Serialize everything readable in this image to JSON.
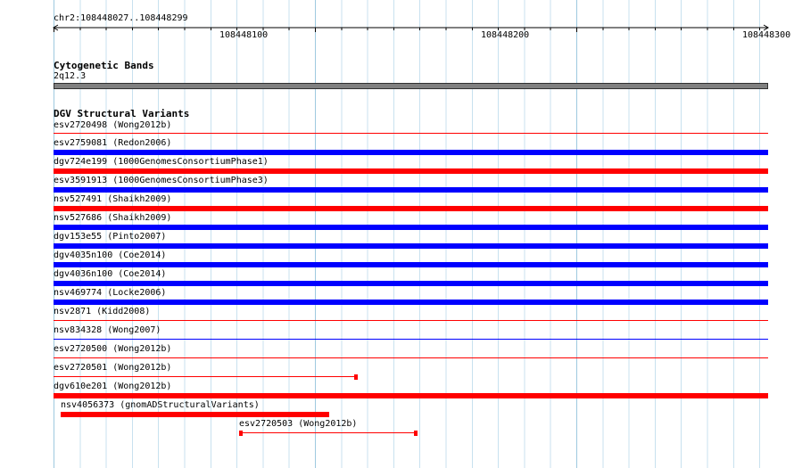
{
  "location_label": "chr2:108448027..108448299",
  "ruler_ticks": [
    "108448100",
    "108448200",
    "108448300"
  ],
  "cytogenetic_bands": {
    "title": "Cytogenetic Bands",
    "band_label": "2q12.3"
  },
  "dgv": {
    "title": "DGV Structural Variants",
    "colors": {
      "loss": "#ff0000",
      "gain": "#0000ff"
    },
    "features": [
      {
        "label": "esv2720498 (Wong2012b)",
        "color": "#ff0000",
        "style": "thin"
      },
      {
        "label": "esv2759081 (Redon2006)",
        "color": "#0000ff",
        "style": "thick"
      },
      {
        "label": "dgv724e199 (1000GenomesConsortiumPhase1)",
        "color": "#ff0000",
        "style": "thick"
      },
      {
        "label": "esv3591913 (1000GenomesConsortiumPhase3)",
        "color": "#0000ff",
        "style": "thick"
      },
      {
        "label": "nsv527491 (Shaikh2009)",
        "color": "#ff0000",
        "style": "thick"
      },
      {
        "label": "nsv527686 (Shaikh2009)",
        "color": "#0000ff",
        "style": "thick"
      },
      {
        "label": "dgv153e55 (Pinto2007)",
        "color": "#0000ff",
        "style": "thick"
      },
      {
        "label": "dgv4035n100 (Coe2014)",
        "color": "#0000ff",
        "style": "thick"
      },
      {
        "label": "dgv4036n100 (Coe2014)",
        "color": "#0000ff",
        "style": "thick"
      },
      {
        "label": "nsv469774 (Locke2006)",
        "color": "#0000ff",
        "style": "thick"
      },
      {
        "label": "nsv2871 (Kidd2008)",
        "color": "#ff0000",
        "style": "thin"
      },
      {
        "label": "nsv834328 (Wong2007)",
        "color": "#0000ff",
        "style": "thin"
      },
      {
        "label": "esv2720500 (Wong2012b)",
        "color": "#ff0000",
        "style": "thin"
      },
      {
        "label": "esv2720501 (Wong2012b)",
        "color": "#ff0000",
        "style": "thin-end"
      },
      {
        "label": "dgv610e201 (Wong2012b)",
        "color": "#ff0000",
        "style": "thick"
      },
      {
        "label": "nsv4056373 (gnomADStructuralVariants)",
        "color": "#ff0000",
        "style": "thick"
      },
      {
        "label": "esv2720503 (Wong2012b)",
        "color": "#ff0000",
        "style": "thin-capped"
      }
    ]
  }
}
